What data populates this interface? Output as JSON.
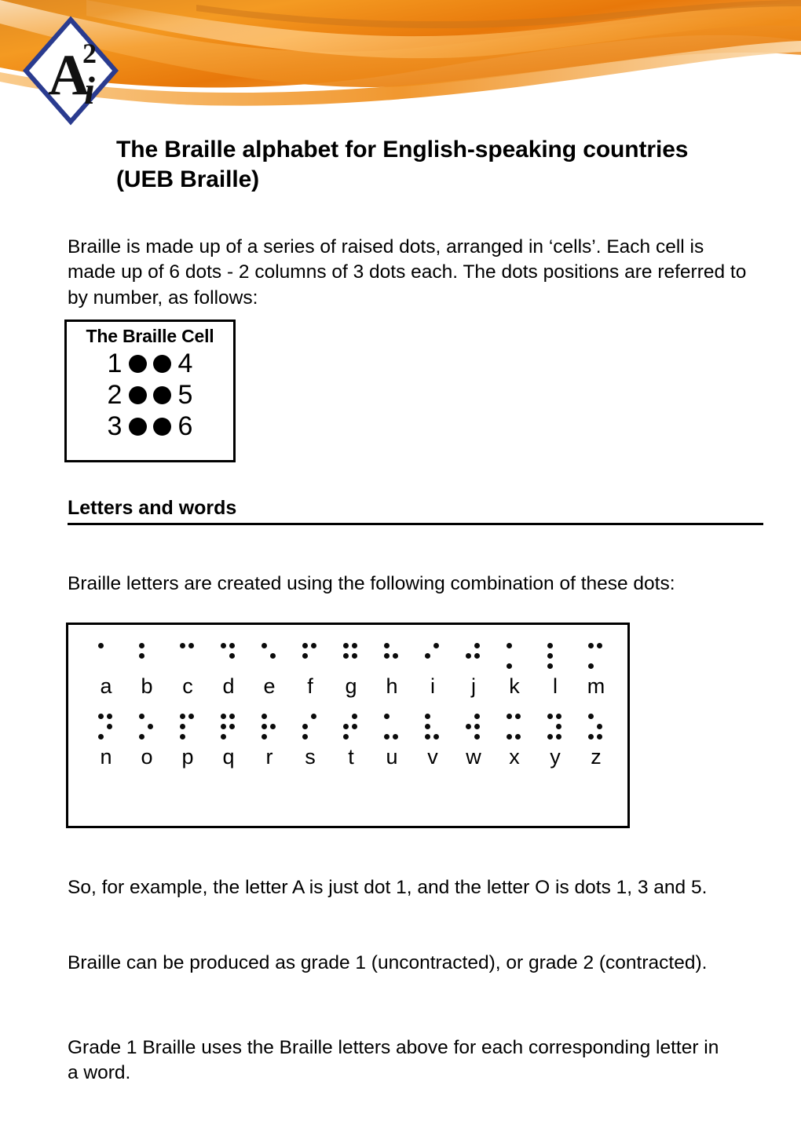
{
  "document": {
    "title": "The Braille alphabet for English-speaking countries (UEB Braille)",
    "logo_text_a": "A",
    "logo_text_sup": "2",
    "logo_text_i": "i"
  },
  "header": {
    "banner_colors": {
      "orange_dark": "#d2690a",
      "orange_mid": "#ef8a1b",
      "orange_light": "#f7b05a",
      "orange_pale": "#fbd9a8"
    },
    "logo_border_color": "#2a3b8f"
  },
  "body_text": {
    "intro": "Braille is made up of a series of raised dots, arranged in ‘cells’. Each cell is made up of 6 dots - 2 columns of 3 dots each. The dots positions are referred to by number, as follows:",
    "letters_intro": "Braille letters are created using the following combination of these dots:",
    "example": "So, for example, the letter A is just dot 1, and the letter O is dots 1, 3 and 5.",
    "grades": "Braille can be produced as grade 1 (uncontracted), or grade 2 (contracted).",
    "grade1": "Grade 1 Braille uses the Braille letters above for each corresponding letter in a word."
  },
  "sections": {
    "letters_and_words_heading": "Letters and words"
  },
  "braille_cell_figure": {
    "title": "The Braille Cell",
    "rows": [
      {
        "left_number": "1",
        "right_number": "4"
      },
      {
        "left_number": "2",
        "right_number": "5"
      },
      {
        "left_number": "3",
        "right_number": "6"
      }
    ]
  },
  "braille_alphabet": {
    "row1": [
      {
        "letter": "a",
        "dots": [
          1
        ]
      },
      {
        "letter": "b",
        "dots": [
          1,
          2
        ]
      },
      {
        "letter": "c",
        "dots": [
          1,
          4
        ]
      },
      {
        "letter": "d",
        "dots": [
          1,
          4,
          5
        ]
      },
      {
        "letter": "e",
        "dots": [
          1,
          5
        ]
      },
      {
        "letter": "f",
        "dots": [
          1,
          2,
          4
        ]
      },
      {
        "letter": "g",
        "dots": [
          1,
          2,
          4,
          5
        ]
      },
      {
        "letter": "h",
        "dots": [
          1,
          2,
          5
        ]
      },
      {
        "letter": "i",
        "dots": [
          2,
          4
        ]
      },
      {
        "letter": "j",
        "dots": [
          2,
          4,
          5
        ]
      },
      {
        "letter": "k",
        "dots": [
          1,
          3
        ]
      },
      {
        "letter": "l",
        "dots": [
          1,
          2,
          3
        ]
      },
      {
        "letter": "m",
        "dots": [
          1,
          3,
          4
        ]
      }
    ],
    "row2": [
      {
        "letter": "n",
        "dots": [
          1,
          3,
          4,
          5
        ]
      },
      {
        "letter": "o",
        "dots": [
          1,
          3,
          5
        ]
      },
      {
        "letter": "p",
        "dots": [
          1,
          2,
          3,
          4
        ]
      },
      {
        "letter": "q",
        "dots": [
          1,
          2,
          3,
          4,
          5
        ]
      },
      {
        "letter": "r",
        "dots": [
          1,
          2,
          3,
          5
        ]
      },
      {
        "letter": "s",
        "dots": [
          2,
          3,
          4
        ]
      },
      {
        "letter": "t",
        "dots": [
          2,
          3,
          4,
          5
        ]
      },
      {
        "letter": "u",
        "dots": [
          1,
          3,
          6
        ]
      },
      {
        "letter": "v",
        "dots": [
          1,
          2,
          3,
          6
        ]
      },
      {
        "letter": "w",
        "dots": [
          2,
          4,
          5,
          6
        ]
      },
      {
        "letter": "x",
        "dots": [
          1,
          3,
          4,
          6
        ]
      },
      {
        "letter": "y",
        "dots": [
          1,
          3,
          4,
          5,
          6
        ]
      },
      {
        "letter": "z",
        "dots": [
          1,
          3,
          5,
          6
        ]
      }
    ]
  }
}
